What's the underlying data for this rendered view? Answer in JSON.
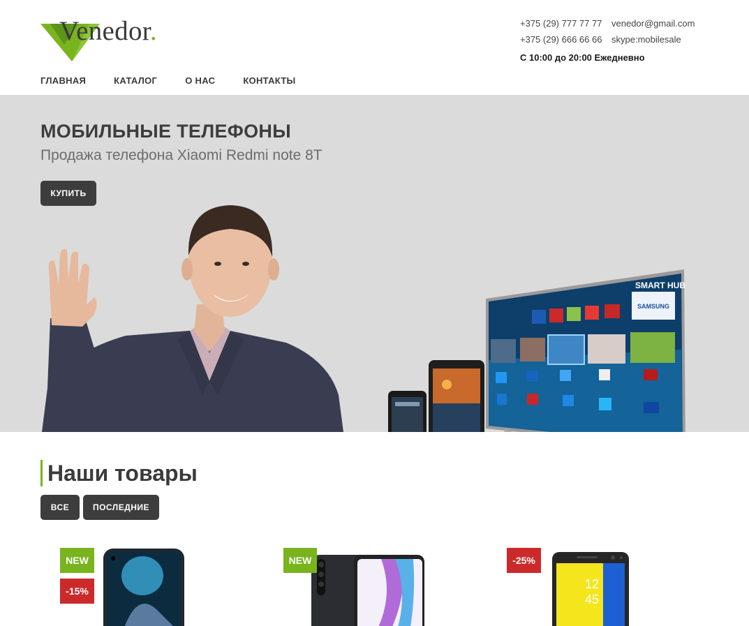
{
  "header": {
    "logo": {
      "text": "Venedor",
      "dot": "."
    },
    "contacts": {
      "phone1": "+375 (29) 777 77 77",
      "email": "venedor@gmail.com",
      "phone2": "+375 (29) 666 66 66",
      "skype": "skype:mobilesale",
      "hours": "С 10:00 до 20:00 Ежедневно"
    },
    "nav": [
      "ГЛАВНАЯ",
      "КАТАЛОГ",
      "О НАС",
      "КОНТАКТЫ"
    ]
  },
  "hero": {
    "title": "МОБИЛЬНЫЕ ТЕЛЕФОНЫ",
    "subtitle": "Продажа телефона Xiaomi Redmi note 8T",
    "button": "КУПИТЬ",
    "tv_brand": "SMART HUB",
    "tv_logo": "SAMSUNG"
  },
  "products_section": {
    "title": "Наши товары",
    "filters": [
      "ВСЕ",
      "ПОСЛЕДНИЕ"
    ],
    "items": [
      {
        "badges": [
          {
            "type": "new",
            "text": "NEW"
          },
          {
            "type": "sale",
            "text": "-15%"
          }
        ]
      },
      {
        "badges": [
          {
            "type": "new",
            "text": "NEW"
          }
        ]
      },
      {
        "badges": [
          {
            "type": "sale",
            "text": "-25%"
          }
        ]
      }
    ]
  },
  "colors": {
    "accent": "#79b41f",
    "dark_button": "#3d3d3d",
    "hero_bg": "#dbdbdb",
    "sale": "#cc2a2a"
  }
}
